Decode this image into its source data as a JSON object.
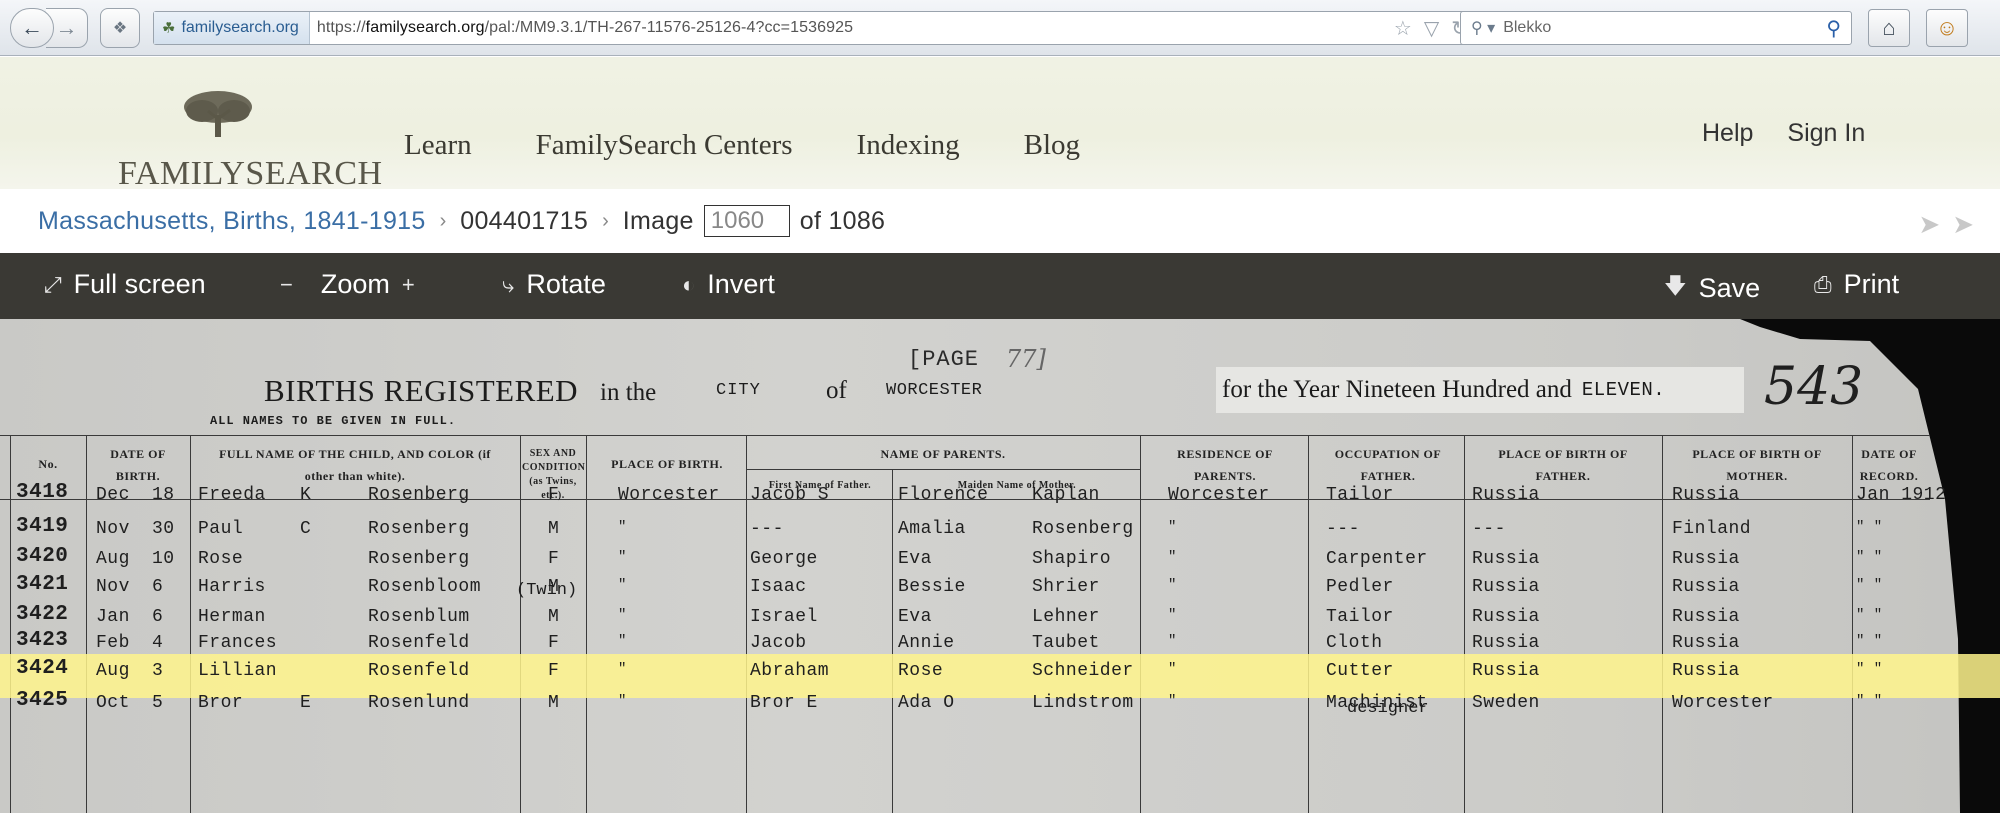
{
  "browser": {
    "identity": "familysearch.org",
    "url_prefix": "https://",
    "url_domain": "familysearch.org",
    "url_path": "/pal:/MM9.3.1/TH-267-11576-25126-4?cc=1536925",
    "search_placeholder": "Blekko"
  },
  "site": {
    "logo_text": "FAMILYSEARCH",
    "nav": [
      "Learn",
      "FamilySearch Centers",
      "Indexing",
      "Blog"
    ],
    "help": "Help",
    "sign_in": "Sign In"
  },
  "breadcrumb": {
    "collection": "Massachusetts, Births, 1841-1915",
    "film": "004401715",
    "image_label": "Image",
    "image_value": "1060",
    "of_total": "of 1086"
  },
  "toolbar": {
    "fullscreen": "Full screen",
    "zoom": "Zoom",
    "rotate": "Rotate",
    "invert": "Invert",
    "save": "Save",
    "print": "Print"
  },
  "document": {
    "page_label": "[PAGE",
    "page_hand": "77]",
    "title_a": "BIRTHS REGISTERED",
    "title_b": "in the",
    "city": "CITY",
    "of": "of",
    "town": "WORCESTER",
    "year_text": "for the Year Nineteen Hundred and",
    "year_word": "ELEVEN.",
    "page_number": "543",
    "all_names": "ALL NAMES TO BE GIVEN IN FULL.",
    "headers": {
      "no": "No.",
      "date": "DATE OF BIRTH.",
      "name": "FULL NAME OF THE CHILD, AND COLOR (if other than white).",
      "sex": "SEX AND CONDITION (as Twins, etc.).",
      "place": "PLACE OF BIRTH.",
      "parents": "NAME OF PARENTS.",
      "father_first": "First Name of Father.",
      "mother_maiden": "Maiden Name of Mother.",
      "residence": "RESIDENCE OF PARENTS.",
      "occupation": "OCCUPATION OF FATHER.",
      "pob_father": "PLACE OF BIRTH OF FATHER.",
      "pob_mother": "PLACE OF BIRTH OF MOTHER.",
      "date_record": "DATE OF RECORD."
    },
    "rows": [
      {
        "no": "3418",
        "month": "Dec",
        "day": "18",
        "first": "Freeda",
        "mid": "K",
        "last": "Rosenberg",
        "sex": "F",
        "place": "Worcester",
        "father": "Jacob S",
        "mother_first": "Florence",
        "mother_last": "Kaplan",
        "residence": "Worcester",
        "occupation": "Tailor",
        "pob_father": "Russia",
        "pob_mother": "Russia",
        "record": "Jan 1912"
      },
      {
        "no": "3419",
        "month": "Nov",
        "day": "30",
        "first": "Paul",
        "mid": "C",
        "last": "Rosenberg",
        "sex": "M",
        "place": "\"",
        "father": "---",
        "mother_first": "Amalia",
        "mother_last": "Rosenberg",
        "residence": "\"",
        "occupation": "---",
        "pob_father": "---",
        "pob_mother": "Finland",
        "record": "\" \""
      },
      {
        "no": "3420",
        "month": "Aug",
        "day": "10",
        "first": "Rose",
        "mid": "",
        "last": "Rosenberg",
        "sex": "F",
        "place": "\"",
        "father": "George",
        "mother_first": "Eva",
        "mother_last": "Shapiro",
        "residence": "\"",
        "occupation": "Carpenter",
        "pob_father": "Russia",
        "pob_mother": "Russia",
        "record": "\" \""
      },
      {
        "no": "3421",
        "month": "Nov",
        "day": "6",
        "first": "Harris",
        "mid": "",
        "last": "Rosenbloom",
        "sex": "M",
        "place": "\"",
        "father": "Isaac",
        "mother_first": "Bessie",
        "mother_last": "Shrier",
        "residence": "\"",
        "occupation": "Pedler",
        "pob_father": "Russia",
        "pob_mother": "Russia",
        "record": "\" \""
      },
      {
        "no": "3422",
        "month": "Jan",
        "day": "6",
        "first": "Herman",
        "mid": "",
        "last": "Rosenblum",
        "sex": "M",
        "place": "\"",
        "father": "Israel",
        "mother_first": "Eva",
        "mother_last": "Lehner",
        "residence": "\"",
        "occupation": "Tailor",
        "pob_father": "Russia",
        "pob_mother": "Russia",
        "record": "\" \""
      },
      {
        "no": "3423",
        "month": "Feb",
        "day": "4",
        "first": "Frances",
        "mid": "",
        "last": "Rosenfeld",
        "sex": "F",
        "place": "\"",
        "father": "Jacob",
        "mother_first": "Annie",
        "mother_last": "Taubet",
        "residence": "\"",
        "occupation": "Cloth",
        "pob_father": "Russia",
        "pob_mother": "Russia",
        "record": "\" \""
      },
      {
        "no": "3424",
        "month": "Aug",
        "day": "3",
        "first": "Lillian",
        "mid": "",
        "last": "Rosenfeld",
        "sex": "F",
        "place": "\"",
        "father": "Abraham",
        "mother_first": "Rose",
        "mother_last": "Schneider",
        "residence": "\"",
        "occupation": "Cutter",
        "pob_father": "Russia",
        "pob_mother": "Russia",
        "record": "\" \""
      },
      {
        "no": "3425",
        "month": "Oct",
        "day": "5",
        "first": "Bror",
        "mid": "E",
        "last": "Rosenlund",
        "sex": "M",
        "place": "\"",
        "father": "Bror E",
        "mother_first": "Ada O",
        "mother_last": "Lindstrom",
        "residence": "\"",
        "occupation": "Machinist",
        "pob_father": "Sweden",
        "pob_mother": "Worcester",
        "record": "\" \""
      }
    ],
    "twin_note": "(Twin)",
    "designer_note": "designer"
  }
}
